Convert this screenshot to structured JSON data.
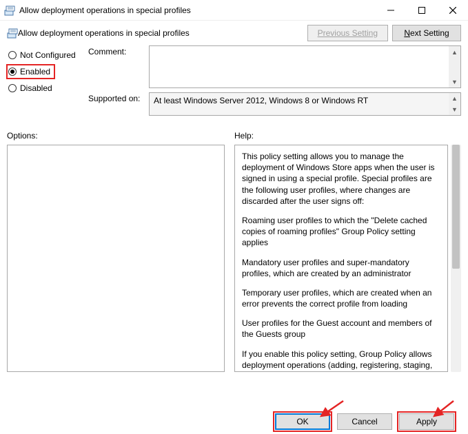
{
  "window": {
    "title": "Allow deployment operations in special profiles"
  },
  "header": {
    "label": "Allow deployment operations in special profiles",
    "prev": "Previous Setting",
    "next_prefix": "N",
    "next_rest": "ext Setting"
  },
  "radios": {
    "not_configured": "Not Configured",
    "enabled": "Enabled",
    "disabled": "Disabled"
  },
  "fields": {
    "comment_label": "Comment:",
    "comment_value": "",
    "supported_label": "Supported on:",
    "supported_value": "At least Windows Server 2012, Windows 8 or Windows RT"
  },
  "section": {
    "options": "Options:",
    "help": "Help:"
  },
  "help": {
    "p1": "This policy setting allows you to manage the deployment of Windows Store apps when the user is signed in using a special profile. Special profiles are the following user profiles, where changes are discarded after the user signs off:",
    "p2": "Roaming user profiles to which the \"Delete cached copies of roaming profiles\" Group Policy setting applies",
    "p3": "Mandatory user profiles and super-mandatory profiles, which are created by an administrator",
    "p4": "Temporary user profiles, which are created when an error prevents the correct profile from loading",
    "p5": "User profiles for the Guest account and members of the Guests group",
    "p6": "If you enable this policy setting, Group Policy allows deployment operations (adding, registering, staging, updating, or removing an app package) of Windows Store apps when using a special"
  },
  "buttons": {
    "ok": "OK",
    "cancel": "Cancel",
    "apply": "Apply"
  }
}
